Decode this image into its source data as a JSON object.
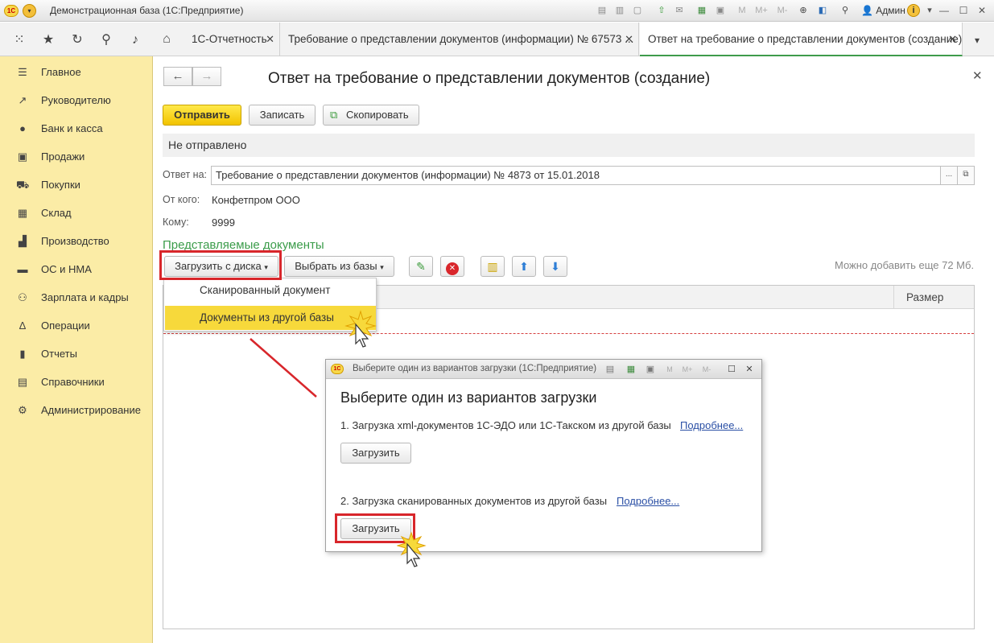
{
  "window": {
    "title": "Демонстрационная база (1С:Предприятие)",
    "logo": "1С",
    "user": "Админ",
    "toolbar_labels": {
      "m": "M",
      "mplus": "M+",
      "mminus": "M-"
    }
  },
  "tabs": [
    {
      "label": "1С-Отчетность"
    },
    {
      "label": "Требование о представлении документов (информации) № 67573 ..."
    },
    {
      "label": "Ответ на требование о представлении документов (создание)"
    }
  ],
  "sidebar": {
    "items": [
      {
        "label": "Главное",
        "icon": "menu-lines-icon"
      },
      {
        "label": "Руководителю",
        "icon": "trend-icon"
      },
      {
        "label": "Банк и касса",
        "icon": "coin-icon"
      },
      {
        "label": "Продажи",
        "icon": "bag-icon"
      },
      {
        "label": "Покупки",
        "icon": "cart-icon"
      },
      {
        "label": "Склад",
        "icon": "warehouse-icon"
      },
      {
        "label": "Производство",
        "icon": "factory-icon"
      },
      {
        "label": "ОС и НМА",
        "icon": "truck-icon"
      },
      {
        "label": "Зарплата и кадры",
        "icon": "people-icon"
      },
      {
        "label": "Операции",
        "icon": "operations-icon"
      },
      {
        "label": "Отчеты",
        "icon": "chart-icon"
      },
      {
        "label": "Справочники",
        "icon": "book-icon"
      },
      {
        "label": "Администрирование",
        "icon": "gear-icon"
      }
    ]
  },
  "form": {
    "title": "Ответ на требование о представлении документов (создание)",
    "send_label": "Отправить",
    "save_label": "Записать",
    "copy_label": "Скопировать",
    "status": "Не отправлено",
    "reply_to_label": "Ответ на:",
    "reply_to_value": "Требование о представлении документов (информации)  № 4873 от 15.01.2018",
    "reply_to_select": "...",
    "from_label": "От кого:",
    "from_value": "Конфетпром ООО",
    "to_label": "Кому:",
    "to_value": "9999",
    "section_title": "Представляемые документы",
    "load_from_disk": "Загрузить с диска",
    "select_from_base": "Выбрать из базы",
    "hint": "Можно добавить еще 72 Мб.",
    "table_col_size": "Размер"
  },
  "dropdown": {
    "items": [
      {
        "label": "Сканированный документ"
      },
      {
        "label": "Документы из другой базы"
      }
    ]
  },
  "dialog": {
    "title": "Выберите один из вариантов загрузки  (1С:Предприятие)",
    "heading": "Выберите один из вариантов загрузки",
    "option1": "1. Загрузка xml-документов 1С-ЭДО или 1С-Такском из другой базы",
    "option2": "2. Загрузка сканированных документов из другой базы",
    "more": "Подробнее...",
    "load": "Загрузить"
  },
  "colors": {
    "sidebar_bg": "#fbeca6",
    "accent_green": "#3e9b4b",
    "send_yellow": "#f7d93b",
    "highlight_red": "#d8262b",
    "link_blue": "#2a4fa5"
  }
}
